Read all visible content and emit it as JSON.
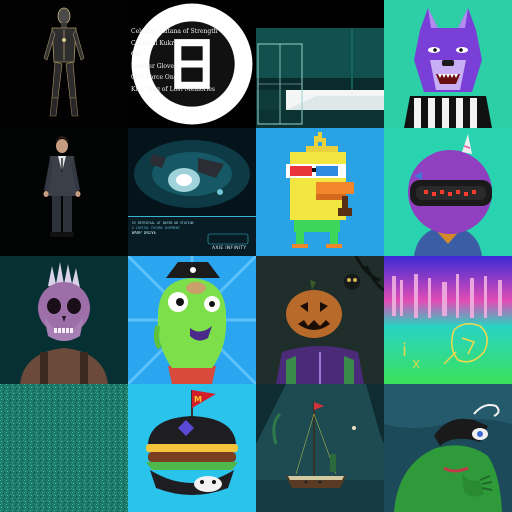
{
  "gallery": {
    "loot_list": {
      "items": [
        "Celestial Katana of Strength",
        "Celestial Kukri",
        "Obi",
        "Leather Gloves",
        "0N1 Force Ones",
        "Kiro Ring of Lost Memories"
      ]
    },
    "tiles": [
      {
        "name": "chrome-humanoid"
      },
      {
        "name": "loot-list"
      },
      {
        "name": "teal-room"
      },
      {
        "name": "purple-wolf-referee"
      },
      {
        "name": "suited-man"
      },
      {
        "name": "ocean-crystal-card",
        "card_lines": [
          "ES RETRIEVAL AT BAFEN OB STATION",
          "X CAPITAL FUTURE SHIPMENT",
          "WARP DRIVE"
        ],
        "brand": "AXIE INFINITY"
      },
      {
        "name": "pixel-duck-3d-glasses"
      },
      {
        "name": "purple-unicorn-robot"
      },
      {
        "name": "mohawk-skull-punk"
      },
      {
        "name": "green-slime-pirate"
      },
      {
        "name": "pumpkin-head-jacket"
      },
      {
        "name": "neon-glitch-art"
      },
      {
        "name": "teal-noise-texture"
      },
      {
        "name": "black-burger-mcdonalds"
      },
      {
        "name": "pirate-ship-night"
      },
      {
        "name": "green-frog-painting"
      }
    ]
  }
}
